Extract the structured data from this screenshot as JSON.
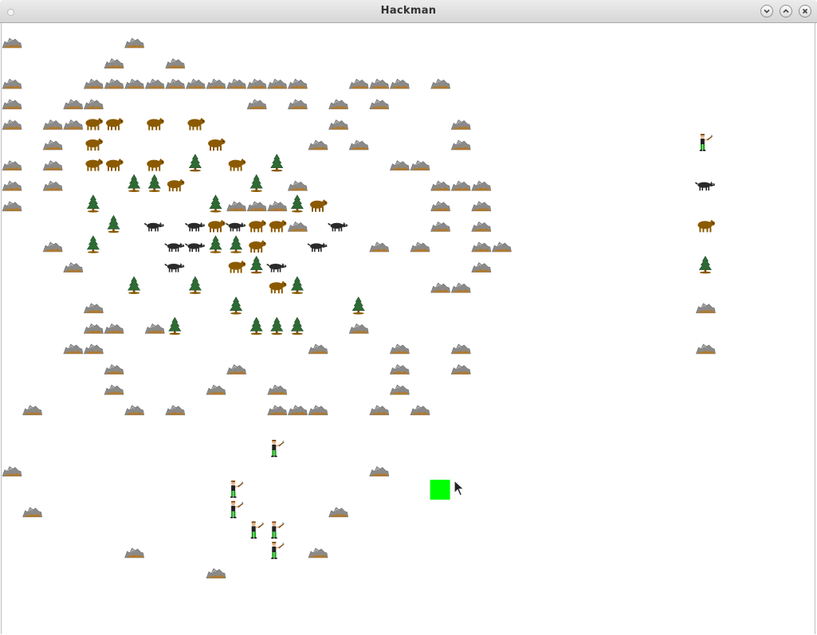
{
  "window": {
    "title": "Hackman"
  },
  "icons": {
    "menu": "window-menu-icon",
    "minimize": "minimize-icon",
    "maximize": "maximize-icon",
    "close": "close-icon",
    "cursor": "mouse-pointer-icon"
  },
  "colors": {
    "rock": "#8a8a8a",
    "bear": "#8b5a00",
    "wolf": "#2a2a2a",
    "tree": "#2e6b34",
    "hunter_pants": "#1aa31a",
    "player": "#00ff00"
  },
  "grid": {
    "columns": 40,
    "rows": 30
  },
  "entities": {
    "rocks": [
      [
        0,
        0
      ],
      [
        6,
        0
      ],
      [
        5,
        1
      ],
      [
        8,
        1
      ],
      [
        0,
        2
      ],
      [
        4,
        2
      ],
      [
        5,
        2
      ],
      [
        6,
        2
      ],
      [
        7,
        2
      ],
      [
        8,
        2
      ],
      [
        9,
        2
      ],
      [
        10,
        2
      ],
      [
        11,
        2
      ],
      [
        12,
        2
      ],
      [
        13,
        2
      ],
      [
        14,
        2
      ],
      [
        17,
        2
      ],
      [
        18,
        2
      ],
      [
        19,
        2
      ],
      [
        21,
        2
      ],
      [
        0,
        3
      ],
      [
        3,
        3
      ],
      [
        4,
        3
      ],
      [
        12,
        3
      ],
      [
        14,
        3
      ],
      [
        16,
        3
      ],
      [
        18,
        3
      ],
      [
        0,
        4
      ],
      [
        2,
        4
      ],
      [
        3,
        4
      ],
      [
        16,
        4
      ],
      [
        22,
        4
      ],
      [
        2,
        5
      ],
      [
        15,
        5
      ],
      [
        17,
        5
      ],
      [
        22,
        5
      ],
      [
        0,
        6
      ],
      [
        2,
        6
      ],
      [
        19,
        6
      ],
      [
        20,
        6
      ],
      [
        0,
        7
      ],
      [
        2,
        7
      ],
      [
        14,
        7
      ],
      [
        21,
        7
      ],
      [
        22,
        7
      ],
      [
        23,
        7
      ],
      [
        0,
        8
      ],
      [
        11,
        8
      ],
      [
        12,
        8
      ],
      [
        13,
        8
      ],
      [
        21,
        8
      ],
      [
        23,
        8
      ],
      [
        14,
        9
      ],
      [
        21,
        9
      ],
      [
        23,
        9
      ],
      [
        2,
        10
      ],
      [
        18,
        10
      ],
      [
        20,
        10
      ],
      [
        23,
        10
      ],
      [
        24,
        10
      ],
      [
        3,
        11
      ],
      [
        23,
        11
      ],
      [
        21,
        12
      ],
      [
        22,
        12
      ],
      [
        4,
        13
      ],
      [
        4,
        14
      ],
      [
        5,
        14
      ],
      [
        7,
        14
      ],
      [
        17,
        14
      ],
      [
        3,
        15
      ],
      [
        4,
        15
      ],
      [
        15,
        15
      ],
      [
        19,
        15
      ],
      [
        22,
        15
      ],
      [
        5,
        16
      ],
      [
        11,
        16
      ],
      [
        19,
        16
      ],
      [
        22,
        16
      ],
      [
        5,
        17
      ],
      [
        10,
        17
      ],
      [
        13,
        17
      ],
      [
        19,
        17
      ],
      [
        1,
        18
      ],
      [
        6,
        18
      ],
      [
        8,
        18
      ],
      [
        13,
        18
      ],
      [
        14,
        18
      ],
      [
        15,
        18
      ],
      [
        18,
        18
      ],
      [
        20,
        18
      ],
      [
        0,
        21
      ],
      [
        18,
        21
      ],
      [
        1,
        23
      ],
      [
        16,
        23
      ],
      [
        6,
        25
      ],
      [
        15,
        25
      ],
      [
        10,
        26
      ],
      [
        34,
        13
      ],
      [
        34,
        15
      ]
    ],
    "bears": [
      [
        4,
        4
      ],
      [
        5,
        4
      ],
      [
        7,
        4
      ],
      [
        9,
        4
      ],
      [
        4,
        5
      ],
      [
        10,
        5
      ],
      [
        4,
        6
      ],
      [
        5,
        6
      ],
      [
        7,
        6
      ],
      [
        11,
        6
      ],
      [
        8,
        7
      ],
      [
        15,
        8
      ],
      [
        10,
        9
      ],
      [
        12,
        9
      ],
      [
        13,
        9
      ],
      [
        12,
        10
      ],
      [
        11,
        11
      ],
      [
        13,
        12
      ],
      [
        34,
        9
      ]
    ],
    "wolves": [
      [
        7,
        9
      ],
      [
        9,
        9
      ],
      [
        11,
        9
      ],
      [
        16,
        9
      ],
      [
        8,
        10
      ],
      [
        9,
        10
      ],
      [
        15,
        10
      ],
      [
        8,
        11
      ],
      [
        13,
        11
      ],
      [
        34,
        7
      ]
    ],
    "trees": [
      [
        9,
        6
      ],
      [
        13,
        6
      ],
      [
        6,
        7
      ],
      [
        7,
        7
      ],
      [
        12,
        7
      ],
      [
        4,
        8
      ],
      [
        10,
        8
      ],
      [
        14,
        8
      ],
      [
        5,
        9
      ],
      [
        4,
        10
      ],
      [
        10,
        10
      ],
      [
        11,
        10
      ],
      [
        12,
        11
      ],
      [
        6,
        12
      ],
      [
        9,
        12
      ],
      [
        14,
        12
      ],
      [
        11,
        13
      ],
      [
        17,
        13
      ],
      [
        8,
        14
      ],
      [
        12,
        14
      ],
      [
        13,
        14
      ],
      [
        14,
        14
      ],
      [
        34,
        11
      ]
    ],
    "hunters": [
      [
        34,
        5
      ],
      [
        13,
        20
      ],
      [
        11,
        22
      ],
      [
        11,
        23
      ],
      [
        12,
        24
      ],
      [
        13,
        24
      ],
      [
        13,
        25
      ]
    ],
    "player": [
      21,
      22
    ]
  }
}
